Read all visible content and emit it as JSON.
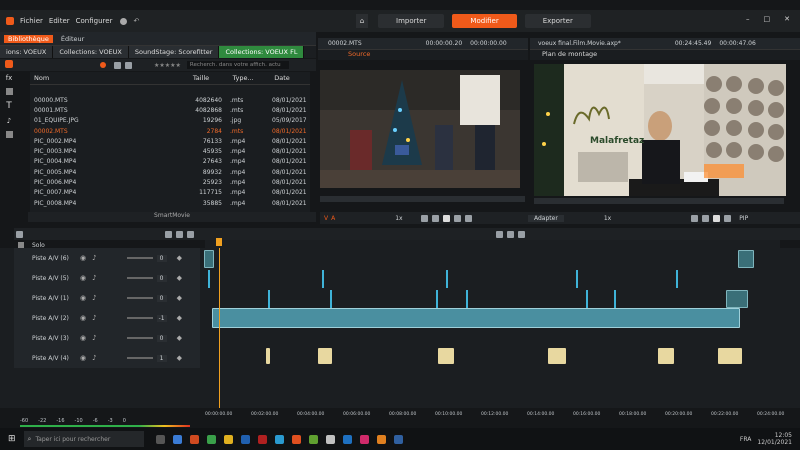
{
  "window": {
    "menu": [
      "Fichier",
      "Editer",
      "Configurer"
    ],
    "top_tabs": [
      "Importer",
      "Modifier",
      "Exporter"
    ],
    "active_tab": "Modifier"
  },
  "library": {
    "title": "Bibliothèque",
    "editor_btn": "Éditeur",
    "tabs": [
      "ions: VOEUX",
      "Collections: VOEUX",
      "SoundStage: Scorefitter",
      "Collections: VOEUX FL"
    ],
    "search_placeholder": "Recherch. dans votre affich. actu",
    "columns": [
      "Nom",
      "Taille",
      "Type...",
      "Date"
    ],
    "files": [
      {
        "name": "00000.MTS",
        "size": "4082640",
        ".type": "",
        "type": ".mts",
        "date": "08/01/2021"
      },
      {
        "name": "00001.MTS",
        "size": "4082868",
        "type": ".mts",
        "date": "08/01/2021"
      },
      {
        "name": "01_EQUIPE.JPG",
        "size": "19296",
        "type": ".jpg",
        "date": "05/09/2017"
      },
      {
        "name": "00002.MTS",
        "size": "2784",
        "type": ".mts",
        "date": "08/01/2021"
      },
      {
        "name": "PIC_0002.MP4",
        "size": "76133",
        "type": ".mp4",
        "date": "08/01/2021"
      },
      {
        "name": "PIC_0003.MP4",
        "size": "45935",
        "type": ".mp4",
        "date": "08/01/2021"
      },
      {
        "name": "PIC_0004.MP4",
        "size": "27643",
        "type": ".mp4",
        "date": "08/01/2021"
      },
      {
        "name": "PIC_0005.MP4",
        "size": "89932",
        "type": ".mp4",
        "date": "08/01/2021"
      },
      {
        "name": "PIC_0006.MP4",
        "size": "25923",
        "type": ".mp4",
        "date": "08/01/2021"
      },
      {
        "name": "PIC_0007.MP4",
        "size": "117715",
        "type": ".mp4",
        "date": "08/01/2021"
      },
      {
        "name": "PIC_0008.MP4",
        "size": "35885",
        "type": ".mp4",
        "date": "08/01/2021"
      }
    ],
    "selected_index": 3,
    "smartmovie": "SmartMovie"
  },
  "source_preview": {
    "file": "00002.MTS",
    "timecode_in": "00:00:00.20",
    "timecode_tc": "00:00:00.00",
    "label": "Source",
    "speed": "1x"
  },
  "montage_preview": {
    "file": "voeux final.Film.Movie.axp*",
    "timecode_in": "00:24:45.49",
    "timecode_tc": "00:00:47.06",
    "label": "Plan de montage",
    "brand": "Malafretaz",
    "adapter": "Adapter",
    "speed": "1x",
    "pip": "PIP"
  },
  "timeline": {
    "solo": "Solo",
    "tracks": [
      {
        "name": "Piste A/V (6)",
        "level": "0"
      },
      {
        "name": "Piste A/V (5)",
        "level": "0"
      },
      {
        "name": "Piste A/V (1)",
        "level": "0"
      },
      {
        "name": "Piste A/V (2)",
        "level": "-1"
      },
      {
        "name": "Piste A/V (3)",
        "level": "0"
      },
      {
        "name": "Piste A/V (4)",
        "level": "1"
      }
    ],
    "ruler": [
      "00:00:00.00",
      "00:02:00.00",
      "00:04:00.00",
      "00:06:00.00",
      "00:08:00.00",
      "00:10:00.00",
      "00:12:00.00",
      "00:14:00.00",
      "00:16:00.00",
      "00:18:00.00",
      "00:20:00.00",
      "00:22:00.00",
      "00:24:00.00"
    ],
    "meter": [
      "-60",
      "-22",
      "-16",
      "-10",
      "-6",
      "-3",
      "0"
    ]
  },
  "taskbar": {
    "search_placeholder": "Taper ici pour rechercher",
    "lang": "FRA",
    "time": "12:05",
    "date": "12/01/2021"
  }
}
